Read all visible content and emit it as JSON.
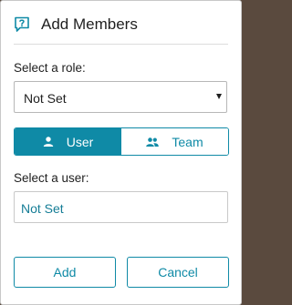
{
  "dialog": {
    "title": "Add Members",
    "icon": "chat-question-icon"
  },
  "role": {
    "label": "Select a role:",
    "selected": "Not Set"
  },
  "member_type": {
    "options": [
      {
        "label": "User",
        "icon": "person-icon",
        "active": true
      },
      {
        "label": "Team",
        "icon": "people-icon",
        "active": false
      }
    ]
  },
  "user": {
    "label": "Select a user:",
    "value": "Not Set"
  },
  "actions": {
    "add_label": "Add",
    "cancel_label": "Cancel"
  },
  "colors": {
    "accent": "#0f8aa6",
    "backdrop": "#5a4a3e",
    "text": "#1f1f1f"
  }
}
